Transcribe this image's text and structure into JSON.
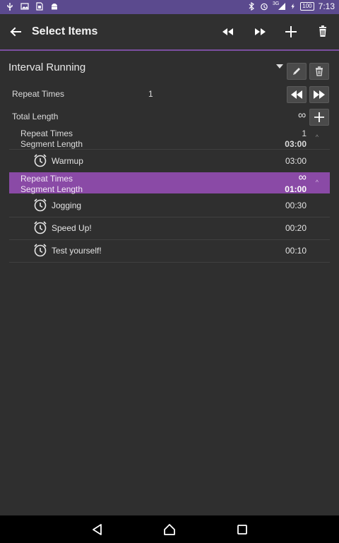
{
  "status_bar": {
    "time": "7:13",
    "battery": "100",
    "signal_label": "3G",
    "left_icons": [
      "usb-icon",
      "image-icon",
      "sim-icon",
      "android-icon"
    ],
    "right_icons": [
      "bluetooth-icon",
      "alarm-icon",
      "signal-icon",
      "battery-icon"
    ]
  },
  "toolbar": {
    "title": "Select Items",
    "back_icon": "arrow-left-icon",
    "actions": [
      "rewind-icon",
      "fast-forward-icon",
      "plus-icon",
      "trash-icon"
    ]
  },
  "playlist": {
    "name": "Interval Running",
    "repeat_label": "Repeat Times",
    "repeat_value": "1",
    "total_label": "Total Length",
    "total_value": "∞"
  },
  "segments": [
    {
      "repeat_label": "Repeat Times",
      "repeat_value": "1",
      "length_label": "Segment Length",
      "length_value": "03:00",
      "selected": false,
      "items": [
        {
          "name": "Warmup",
          "duration": "03:00"
        }
      ]
    },
    {
      "repeat_label": "Repeat Times",
      "repeat_value": "∞",
      "length_label": "Segment Length",
      "length_value": "01:00",
      "selected": true,
      "items": [
        {
          "name": "Jogging",
          "duration": "00:30"
        },
        {
          "name": "Speed Up!",
          "duration": "00:20"
        },
        {
          "name": "Test yourself!",
          "duration": "00:10"
        }
      ]
    }
  ],
  "colors": {
    "status_bar": "#5b4a8e",
    "accent": "#7b4fa0",
    "selected_row": "#8a4aa6",
    "background": "#2f2f2f"
  },
  "nav": [
    "back-triangle-icon",
    "home-icon",
    "recents-icon"
  ]
}
